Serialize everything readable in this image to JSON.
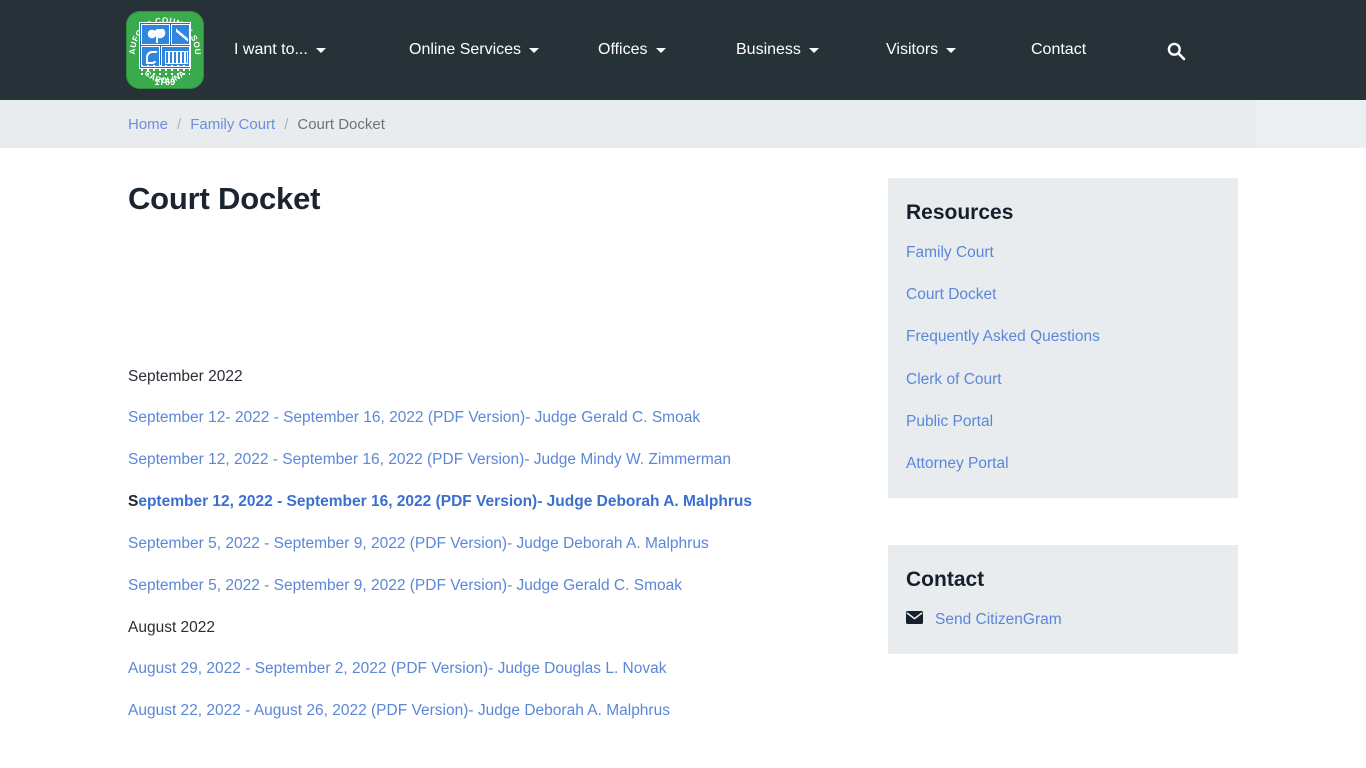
{
  "header": {
    "logo": {
      "name": "beaufort-county-seal",
      "ring_top": "BEAUFORT COUNTY SOUTH",
      "ring_bottom": "CAROLINA",
      "year": "1769"
    },
    "nav": [
      {
        "label": "I want to...",
        "has_caret": true
      },
      {
        "label": "Online Services",
        "has_caret": true
      },
      {
        "label": "Offices",
        "has_caret": true
      },
      {
        "label": "Business",
        "has_caret": true
      },
      {
        "label": "Visitors",
        "has_caret": true
      },
      {
        "label": "Contact",
        "has_caret": false
      }
    ],
    "search_icon": "search-icon",
    "background_color": "#263238"
  },
  "breadcrumb": {
    "home": "Home",
    "parent": "Family Court",
    "separator": "/",
    "current": "Court Docket"
  },
  "main": {
    "title": "Court Docket",
    "sections": [
      {
        "month": "September 2022",
        "entries": [
          {
            "text": "September 12- 2022 - September 16, 2022 (PDF Version)- Judge Gerald C. Smoak",
            "bold": false,
            "lead_dark": ""
          },
          {
            "text": "September 12, 2022 - September 16, 2022 (PDF Version)- Judge Mindy W. Zimmerman",
            "bold": false,
            "lead_dark": ""
          },
          {
            "text": "eptember 12, 2022 - September 16, 2022 (PDF Version)- Judge Deborah A. Malphrus",
            "bold": true,
            "lead_dark": "S"
          },
          {
            "text": "September 5, 2022 - September 9, 2022 (PDF Version)- Judge Deborah A. Malphrus",
            "bold": false,
            "lead_dark": ""
          },
          {
            "text": "September 5, 2022 - September 9, 2022 (PDF Version)- Judge Gerald C. Smoak",
            "bold": false,
            "lead_dark": ""
          }
        ]
      },
      {
        "month": "August 2022",
        "entries": [
          {
            "text": "August 29, 2022 - September 2, 2022 (PDF Version)- Judge Douglas L. Novak",
            "bold": false,
            "lead_dark": ""
          },
          {
            "text": "August 22, 2022 - August 26, 2022 (PDF Version)- Judge Deborah A. Malphrus",
            "bold": false,
            "lead_dark": ""
          }
        ]
      }
    ]
  },
  "sidebar": {
    "resources": {
      "title": "Resources",
      "links": [
        "Family Court",
        "Court Docket",
        "Frequently Asked Questions",
        "Clerk of Court",
        "Public Portal",
        "Attorney Portal"
      ]
    },
    "contact": {
      "title": "Contact",
      "icon": "envelope-icon",
      "link": "Send CitizenGram"
    },
    "panel_background": "#e8ecef"
  },
  "colors": {
    "header_bg": "#263238",
    "breadcrumb_bg": "#e8ecef",
    "link_blue": "#5b87d9",
    "text_dark": "#1b2431",
    "seal_green": "#3aab4c",
    "seal_blue": "#1f6fc4"
  }
}
